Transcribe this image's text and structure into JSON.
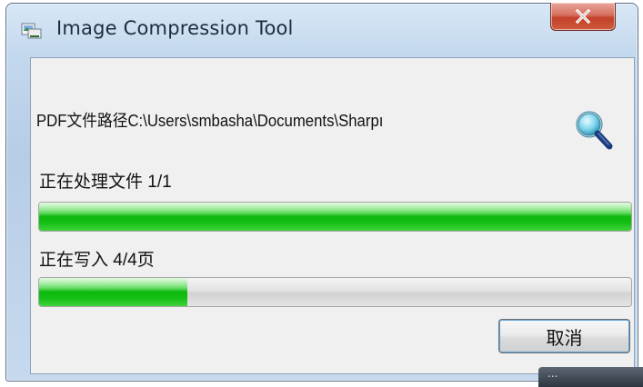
{
  "window": {
    "title": "Image Compression Tool",
    "close_icon": "close-icon",
    "app_icon": "app-icon"
  },
  "dialog": {
    "pdf_path_label": "PDF文件路径C:\\Users\\smbasha\\Documents\\Sharpı",
    "browse_icon": "search-icon",
    "file_status": "正在处理文件 1/1",
    "file_progress": 1.0,
    "page_status": "正在写入 4/4页",
    "page_progress": 0.25,
    "cancel_label": "取消"
  },
  "taskbar": {
    "overflow_text": "..."
  },
  "colors": {
    "progress_fill": "#12bf12",
    "close_button": "#c3412b",
    "accent_border": "#5aa0d8"
  }
}
